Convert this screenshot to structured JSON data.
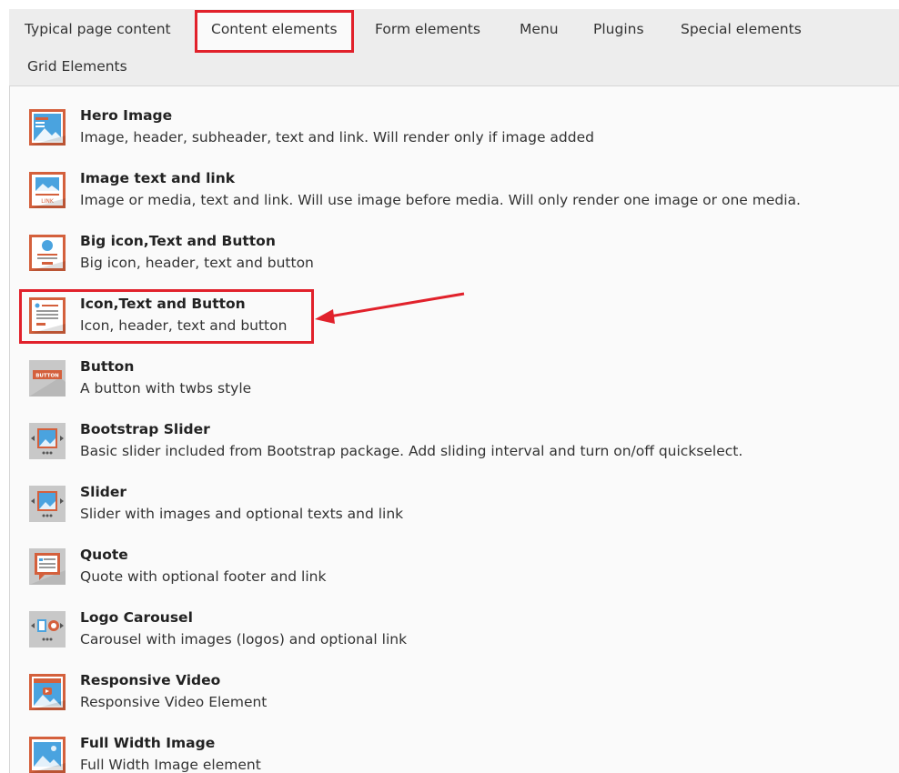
{
  "tabs": [
    {
      "label": "Typical page content"
    },
    {
      "label": "Content elements"
    },
    {
      "label": "Form elements"
    },
    {
      "label": "Menu"
    },
    {
      "label": "Plugins"
    },
    {
      "label": "Special elements"
    },
    {
      "label": "Grid Elements"
    }
  ],
  "active_tab": "Content elements",
  "items": [
    {
      "title": "Hero Image",
      "desc": "Image, header, subheader, text and link. Will render only if image added",
      "icon": "hero-image-icon"
    },
    {
      "title": "Image text and link",
      "desc": "Image or media, text and link. Will use image before media. Will only render one image or one media.",
      "icon": "image-text-link-icon"
    },
    {
      "title": "Big icon,Text and Button",
      "desc": "Big icon, header, text and button",
      "icon": "big-icon-text-button-icon"
    },
    {
      "title": "Icon,Text and Button",
      "desc": "Icon, header, text and button",
      "icon": "icon-text-button-icon"
    },
    {
      "title": "Button",
      "desc": "A button with twbs style",
      "icon": "button-icon",
      "icon_text": "BUTTON"
    },
    {
      "title": "Bootstrap Slider",
      "desc": "Basic slider included from Bootstrap package. Add sliding interval and turn on/off quickselect.",
      "icon": "bootstrap-slider-icon"
    },
    {
      "title": "Slider",
      "desc": "Slider with images and optional texts and link",
      "icon": "slider-icon"
    },
    {
      "title": "Quote",
      "desc": "Quote with optional footer and link",
      "icon": "quote-icon"
    },
    {
      "title": "Logo Carousel",
      "desc": "Carousel with images (logos) and optional link",
      "icon": "logo-carousel-icon"
    },
    {
      "title": "Responsive Video",
      "desc": "Responsive Video Element",
      "icon": "responsive-video-icon"
    },
    {
      "title": "Full Width Image",
      "desc": "Full Width Image element",
      "icon": "full-width-image-icon"
    }
  ],
  "icon_link_text": "LINK",
  "highlighted_item": "Icon,Text and Button",
  "colors": {
    "highlight": "#e1212b",
    "icon_orange": "#d4603c",
    "icon_blue": "#4aa3df",
    "icon_bg": "#ffffff"
  }
}
